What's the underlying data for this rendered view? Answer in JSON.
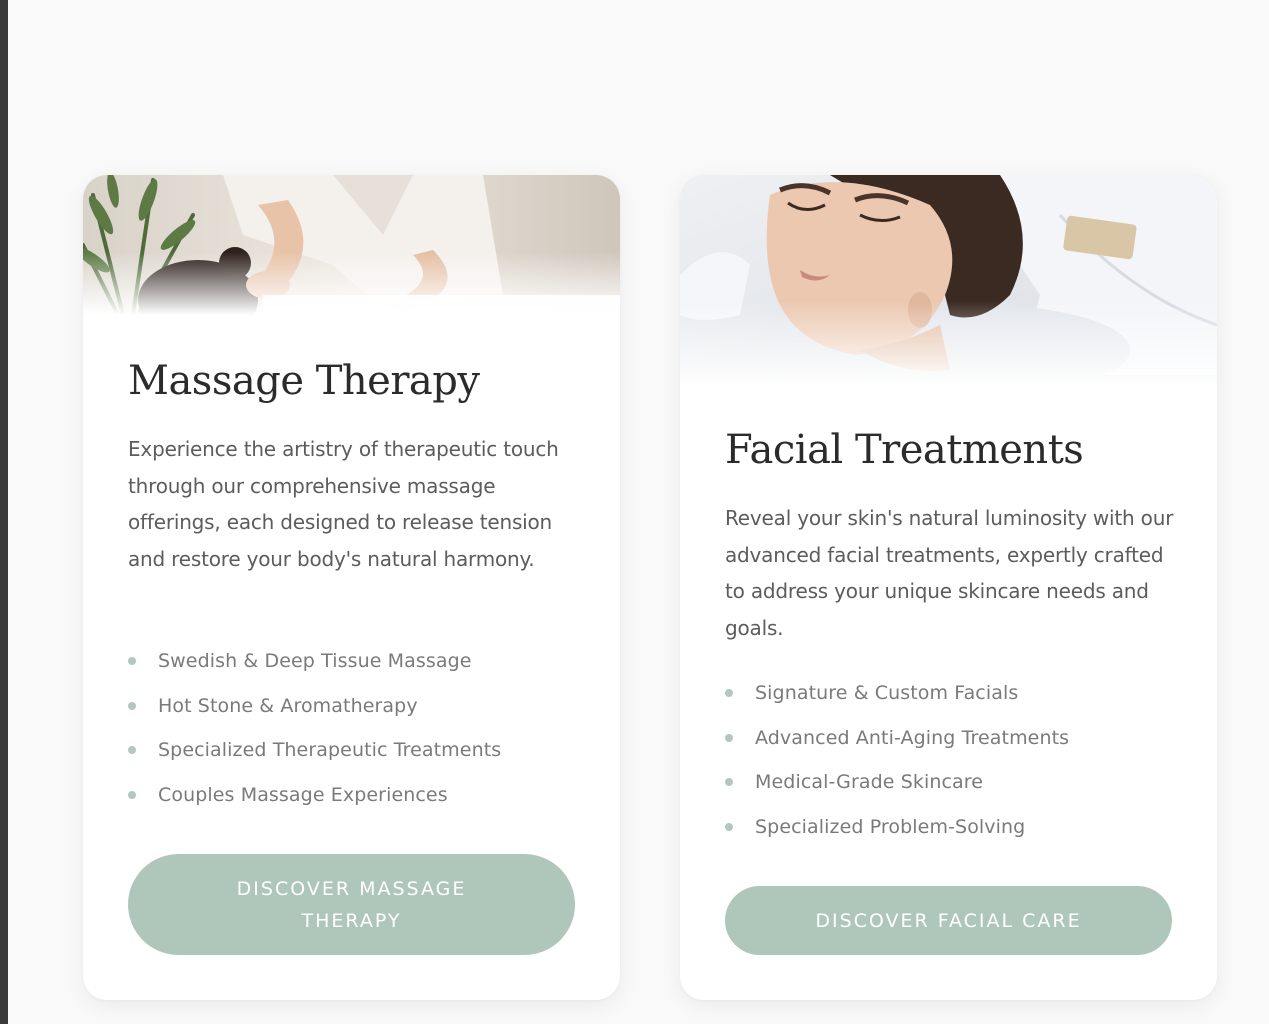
{
  "cards": [
    {
      "title": "Massage Therapy",
      "description": "Experience the artistry of therapeutic touch through our comprehensive massage offerings, each designed to release tension and restore your body's natural harmony.",
      "features": [
        "Swedish & Deep Tissue Massage",
        "Hot Stone & Aromatherapy",
        "Specialized Therapeutic Treatments",
        "Couples Massage Experiences"
      ],
      "button_label": "DISCOVER MASSAGE THERAPY"
    },
    {
      "title": "Facial Treatments",
      "description": "Reveal your skin's natural luminosity with our advanced facial treatments, expertly crafted to address your unique skincare needs and goals.",
      "features": [
        "Signature & Custom Facials",
        "Advanced Anti-Aging Treatments",
        "Medical-Grade Skincare",
        "Specialized Problem-Solving"
      ],
      "button_label": "DISCOVER FACIAL CARE"
    }
  ],
  "colors": {
    "page_background": "#f9f9f9",
    "card_background": "#ffffff",
    "accent_sage": "#afc7bb",
    "title_text": "#2b2b2b",
    "body_text": "#5c5c5c",
    "feature_text": "#7a7a7a"
  }
}
